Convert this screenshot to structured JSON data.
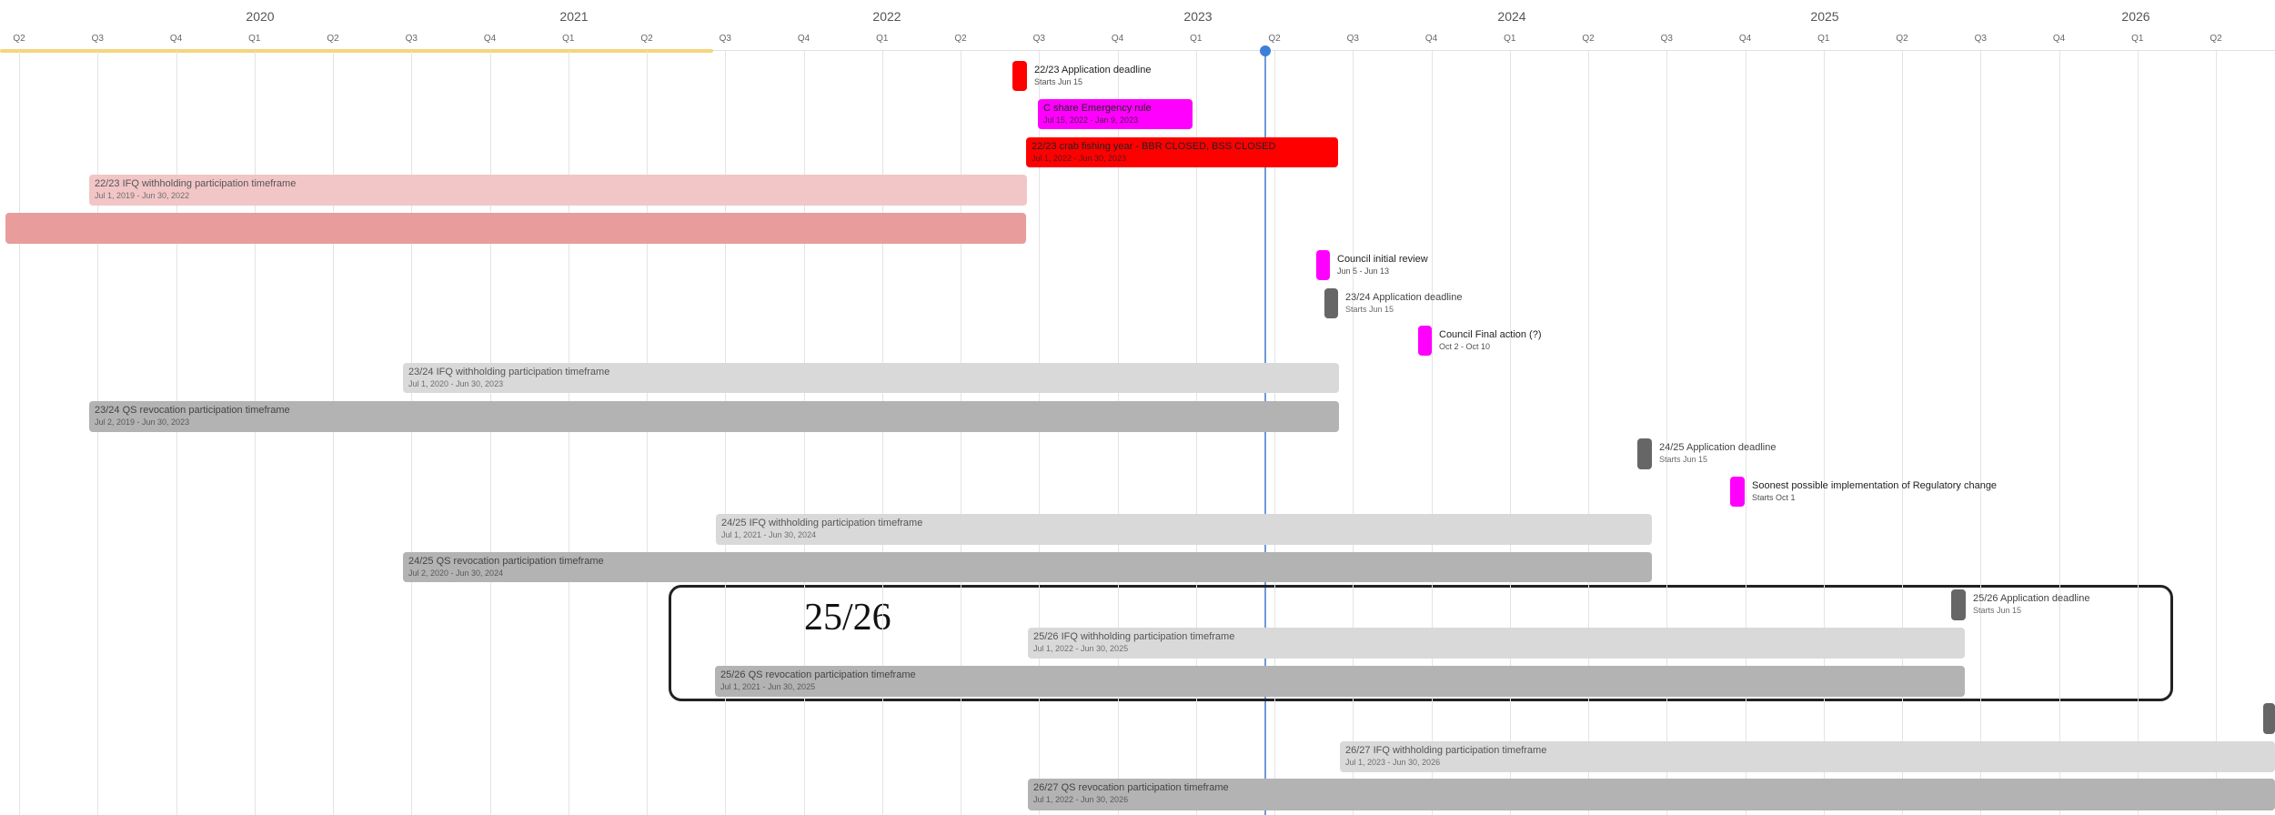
{
  "years": [
    "2020",
    "2021",
    "2022",
    "2023",
    "2024",
    "2025",
    "2026"
  ],
  "quarters": [
    "Q2",
    "Q3",
    "Q4",
    "Q1",
    "Q2",
    "Q3",
    "Q4",
    "Q1",
    "Q2",
    "Q3",
    "Q4",
    "Q1",
    "Q2",
    "Q3",
    "Q4",
    "Q1",
    "Q2",
    "Q3",
    "Q4",
    "Q1",
    "Q2",
    "Q3",
    "Q4",
    "Q1",
    "Q2",
    "Q3",
    "Q4",
    "Q1",
    "Q2"
  ],
  "highlight_label": "25/26",
  "colors": {
    "red": "#ff0000",
    "magenta": "#ff00ff",
    "light_pink": "#f2c6c6",
    "pink": "#e99c9c",
    "light_gray": "#d9d9d9",
    "gray": "#b3b3b3",
    "dark_gray": "#666666",
    "today": "#3d7ed8"
  },
  "tasks": [
    {
      "id": "t1",
      "title": "22/23 Application deadline",
      "subtitle": "Starts Jun 15",
      "color": "red"
    },
    {
      "id": "t2",
      "title": "C share Emergency rule",
      "subtitle": "Jul 15, 2022 - Jan 9, 2023",
      "color": "magenta"
    },
    {
      "id": "t3",
      "title": "22/23 crab fishing year - BBR CLOSED, BSS CLOSED",
      "subtitle": "Jul 1, 2022 - Jun 30, 2023",
      "color": "red"
    },
    {
      "id": "t4",
      "title": "22/23 IFQ withholding participation timeframe",
      "subtitle": "Jul 1, 2019 - Jun 30, 2022",
      "color": "light_pink"
    },
    {
      "id": "t5",
      "title": "",
      "subtitle": "",
      "color": "pink"
    },
    {
      "id": "t6",
      "title": "Council initial review",
      "subtitle": "Jun 5 - Jun 13",
      "color": "magenta"
    },
    {
      "id": "t7",
      "title": "23/24 Application deadline",
      "subtitle": "Starts Jun 15",
      "color": "dark_gray"
    },
    {
      "id": "t8",
      "title": "Council Final action (?)",
      "subtitle": "Oct 2 - Oct 10",
      "color": "magenta"
    },
    {
      "id": "t9",
      "title": "23/24 IFQ withholding participation timeframe",
      "subtitle": "Jul 1, 2020 - Jun 30, 2023",
      "color": "light_gray"
    },
    {
      "id": "t10",
      "title": "23/24 QS revocation participation timeframe",
      "subtitle": "Jul 2, 2019 - Jun 30, 2023",
      "color": "gray"
    },
    {
      "id": "t11",
      "title": "24/25 Application deadline",
      "subtitle": "Starts Jun 15",
      "color": "dark_gray"
    },
    {
      "id": "t12",
      "title": "Soonest possible implementation of Regulatory change",
      "subtitle": "Starts Oct 1",
      "color": "magenta"
    },
    {
      "id": "t13",
      "title": "24/25 IFQ withholding participation timeframe",
      "subtitle": "Jul 1, 2021 - Jun 30, 2024",
      "color": "light_gray"
    },
    {
      "id": "t14",
      "title": "24/25 QS revocation participation timeframe",
      "subtitle": "Jul 2, 2020 - Jun 30, 2024",
      "color": "gray"
    },
    {
      "id": "t15",
      "title": "25/26 Application deadline",
      "subtitle": "Starts Jun 15",
      "color": "dark_gray"
    },
    {
      "id": "t16",
      "title": "25/26 IFQ withholding participation timeframe",
      "subtitle": "Jul 1, 2022 - Jun 30, 2025",
      "color": "light_gray"
    },
    {
      "id": "t17",
      "title": "25/26 QS revocation participation timeframe",
      "subtitle": "Jul 1, 2021 - Jun 30, 2025",
      "color": "gray"
    },
    {
      "id": "t18",
      "title": "",
      "subtitle": "",
      "color": "dark_gray"
    },
    {
      "id": "t19",
      "title": "26/27 IFQ withholding participation timeframe",
      "subtitle": "Jul 1, 2023 - Jun 30, 2026",
      "color": "light_gray"
    },
    {
      "id": "t20",
      "title": "26/27 QS revocation participation timeframe",
      "subtitle": "Jul 1, 2022 - Jun 30, 2026",
      "color": "gray"
    }
  ]
}
